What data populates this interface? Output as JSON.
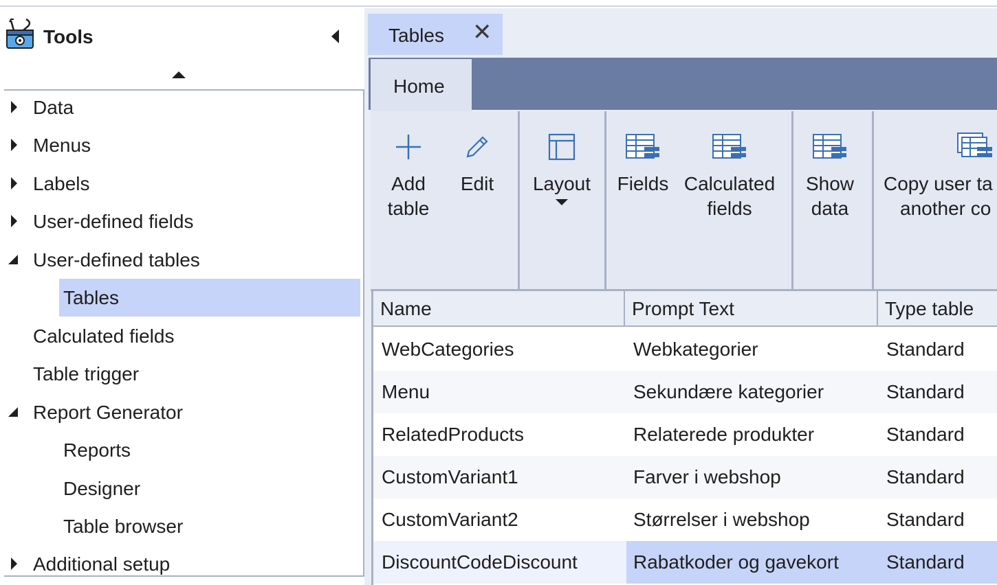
{
  "sidebar": {
    "title": "Tools",
    "items": [
      {
        "label": "Data",
        "state": "collapsed",
        "level": 0
      },
      {
        "label": "Menus",
        "state": "collapsed",
        "level": 0
      },
      {
        "label": "Labels",
        "state": "collapsed",
        "level": 0
      },
      {
        "label": "User-defined fields",
        "state": "collapsed",
        "level": 0
      },
      {
        "label": "User-defined tables",
        "state": "expanded",
        "level": 0
      },
      {
        "label": "Tables",
        "state": "leaf",
        "level": 1,
        "selected": true
      },
      {
        "label": "Calculated fields",
        "state": "leaf",
        "level": 0
      },
      {
        "label": "Table trigger",
        "state": "leaf",
        "level": 0
      },
      {
        "label": "Report Generator",
        "state": "expanded",
        "level": 0
      },
      {
        "label": "Reports",
        "state": "leaf",
        "level": 1
      },
      {
        "label": "Designer",
        "state": "leaf",
        "level": 1
      },
      {
        "label": "Table browser",
        "state": "leaf",
        "level": 1
      },
      {
        "label": "Additional setup",
        "state": "collapsed",
        "level": 0
      }
    ]
  },
  "document_tab": {
    "label": "Tables",
    "close": "✕"
  },
  "ribbon": {
    "tab_home": "Home",
    "buttons": {
      "add_table": [
        "Add",
        "table"
      ],
      "edit": "Edit",
      "layout": "Layout",
      "fields": "Fields",
      "calculated_fields": [
        "Calculated",
        "fields"
      ],
      "show_data": [
        "Show",
        "data"
      ],
      "copy_user_tables": [
        "Copy user ta",
        "another co"
      ]
    }
  },
  "grid": {
    "columns": [
      "Name",
      "Prompt Text",
      "Type table"
    ],
    "rows": [
      [
        "WebCategories",
        "Webkategorier",
        "Standard"
      ],
      [
        "Menu",
        "Sekundære kategorier",
        "Standard"
      ],
      [
        "RelatedProducts",
        "Relaterede produkter",
        "Standard"
      ],
      [
        "CustomVariant1",
        "Farver i webshop",
        "Standard"
      ],
      [
        "CustomVariant2",
        "Størrelser i webshop",
        "Standard"
      ],
      [
        "DiscountCodeDiscount",
        "Rabatkoder og gavekort",
        "Standard"
      ]
    ],
    "selected_row_index": 5
  },
  "colors": {
    "accent_selection": "#c6d4f9",
    "ribbon_bar": "#6b7ca3",
    "panel_bg": "#e9edf5",
    "border": "#a8b1c5",
    "icon_blue": "#3a6fb5"
  }
}
